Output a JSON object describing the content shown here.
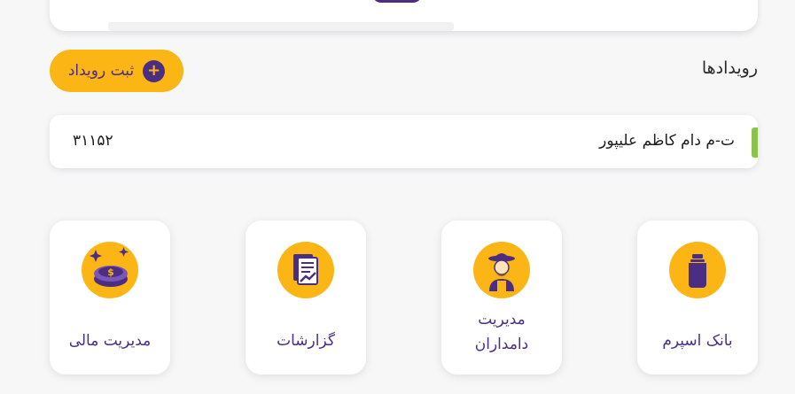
{
  "events": {
    "title": "رویدادها",
    "add_button_label": "ثبت رویداد",
    "add_icon": "+",
    "items": [
      {
        "name": "ت-م دام کاظم علیپور",
        "code": "۳۱۱۵۲"
      }
    ]
  },
  "tiles": [
    {
      "label": "بانک اسپرم",
      "icon": "sperm-bank-icon"
    },
    {
      "label_line1": "مدیریت",
      "label_line2": "دامداران",
      "icon": "farmer-icon"
    },
    {
      "label": "گزارشات",
      "icon": "report-icon"
    },
    {
      "label": "مدیریت مالی",
      "icon": "money-icon"
    }
  ],
  "colors": {
    "accent": "#fbb616",
    "primary": "#4b2e83",
    "event_marker": "#8bc34a"
  }
}
